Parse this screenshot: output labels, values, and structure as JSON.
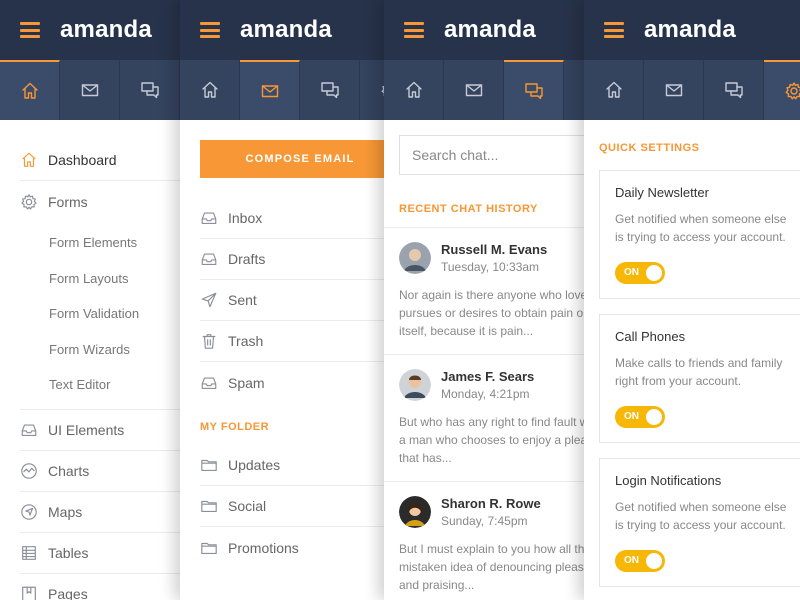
{
  "brand": "amanda",
  "colors": {
    "accent": "#f79735",
    "topbar": "#27334a",
    "iconbar": "#34435e",
    "toggle": "#f7b707"
  },
  "nav": {
    "items": [
      {
        "label": "Dashboard",
        "icon": "home-icon"
      },
      {
        "label": "Forms",
        "icon": "gear-icon"
      },
      {
        "label": "UI Elements",
        "icon": "inbox-icon"
      },
      {
        "label": "Charts",
        "icon": "chart-icon"
      },
      {
        "label": "Maps",
        "icon": "navigation-icon"
      },
      {
        "label": "Tables",
        "icon": "table-icon"
      },
      {
        "label": "Pages",
        "icon": "pages-icon"
      }
    ],
    "form_sub": [
      "Form Elements",
      "Form Layouts",
      "Form Validation",
      "Form Wizards",
      "Text Editor"
    ]
  },
  "mail": {
    "compose_label": "COMPOSE EMAIL",
    "folders": [
      {
        "label": "Inbox",
        "icon": "inbox-icon"
      },
      {
        "label": "Drafts",
        "icon": "inbox-icon"
      },
      {
        "label": "Sent",
        "icon": "send-icon"
      },
      {
        "label": "Trash",
        "icon": "trash-icon"
      },
      {
        "label": "Spam",
        "icon": "inbox-icon"
      }
    ],
    "my_folder_label": "MY FOLDER",
    "my_folders": [
      "Updates",
      "Social",
      "Promotions"
    ]
  },
  "chat": {
    "search_placeholder": "Search chat...",
    "recent_label": "RECENT CHAT HISTORY",
    "items": [
      {
        "name": "Russell M. Evans",
        "time": "Tuesday, 10:33am",
        "lines": [
          "Nor again is there anyone who love",
          "pursues or desires to obtain pain o",
          "itself, because it is pain..."
        ]
      },
      {
        "name": "James F. Sears",
        "time": "Monday, 4:21pm",
        "lines": [
          "But who has any right to find fault w",
          "a man who chooses to enjoy a plea",
          "that has..."
        ]
      },
      {
        "name": "Sharon R. Rowe",
        "time": "Sunday, 7:45pm",
        "lines": [
          "But I must explain to you how all th",
          "mistaken idea of denouncing pleas",
          "and praising..."
        ]
      }
    ]
  },
  "settings": {
    "label": "QUICK SETTINGS",
    "cards": [
      {
        "title": "Daily Newsletter",
        "desc": "Get notified when someone else is trying to access your account.",
        "toggle": "ON"
      },
      {
        "title": "Call Phones",
        "desc": "Make calls to friends and family right from your account.",
        "toggle": "ON"
      },
      {
        "title": "Login Notifications",
        "desc": "Get notified when someone else is trying to access your account.",
        "toggle": "ON"
      }
    ]
  }
}
